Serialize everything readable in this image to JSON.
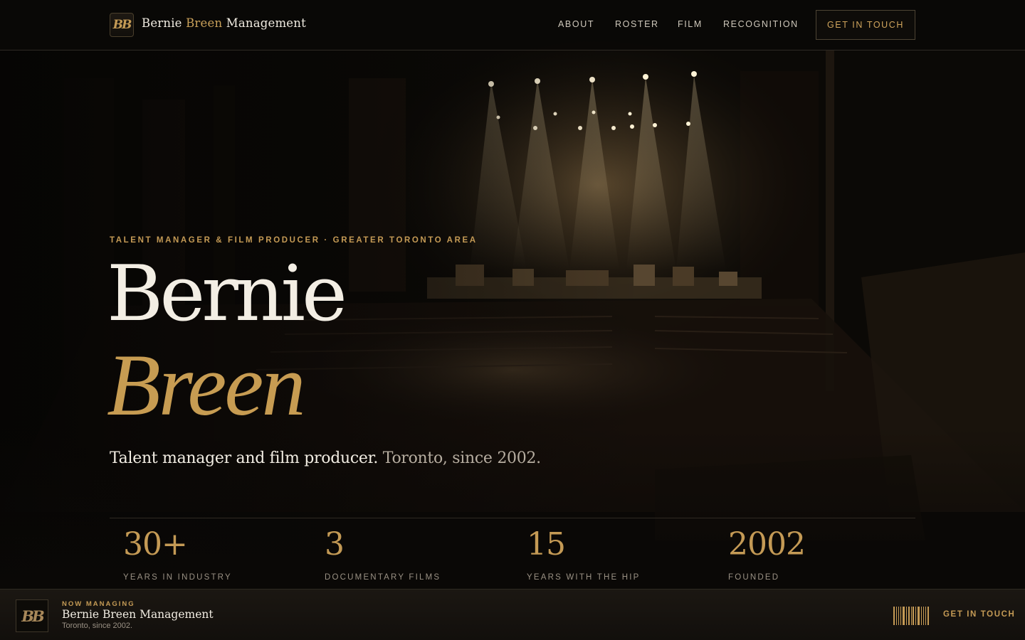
{
  "header": {
    "logo_monogram": "BB",
    "brand_first": "Bernie",
    "brand_accent": "Breen",
    "brand_last": "Management",
    "nav": [
      {
        "label": "ABOUT"
      },
      {
        "label": "ROSTER"
      },
      {
        "label": "FILM"
      },
      {
        "label": "RECOGNITION"
      }
    ],
    "cta_label": "GET IN TOUCH"
  },
  "hero": {
    "eyebrow": "TALENT MANAGER & FILM PRODUCER · GREATER TORONTO AREA",
    "name_first": "Bernie",
    "name_last": "Breen",
    "tagline_main": "Talent manager and film producer.",
    "tagline_muted": "Toronto, since 2002.",
    "background": "concert-stage-photo",
    "stats": [
      {
        "value": "30+",
        "label": "YEARS IN INDUSTRY"
      },
      {
        "value": "3",
        "label": "DOCUMENTARY FILMS"
      },
      {
        "value": "15",
        "label": "YEARS WITH THE HIP"
      },
      {
        "value": "2002",
        "label": "FOUNDED"
      }
    ]
  },
  "now_bar": {
    "logo_monogram": "BB",
    "eyebrow": "NOW MANAGING",
    "title": "Bernie Breen Management",
    "subtitle": "Toronto, since 2002.",
    "icon": "barcode-icon",
    "cta_label": "GET IN TOUCH"
  },
  "colors": {
    "accent_gold": "#c49a55",
    "background": "#0b0906",
    "text_light": "#f1ece2",
    "text_muted": "#9a9184"
  }
}
